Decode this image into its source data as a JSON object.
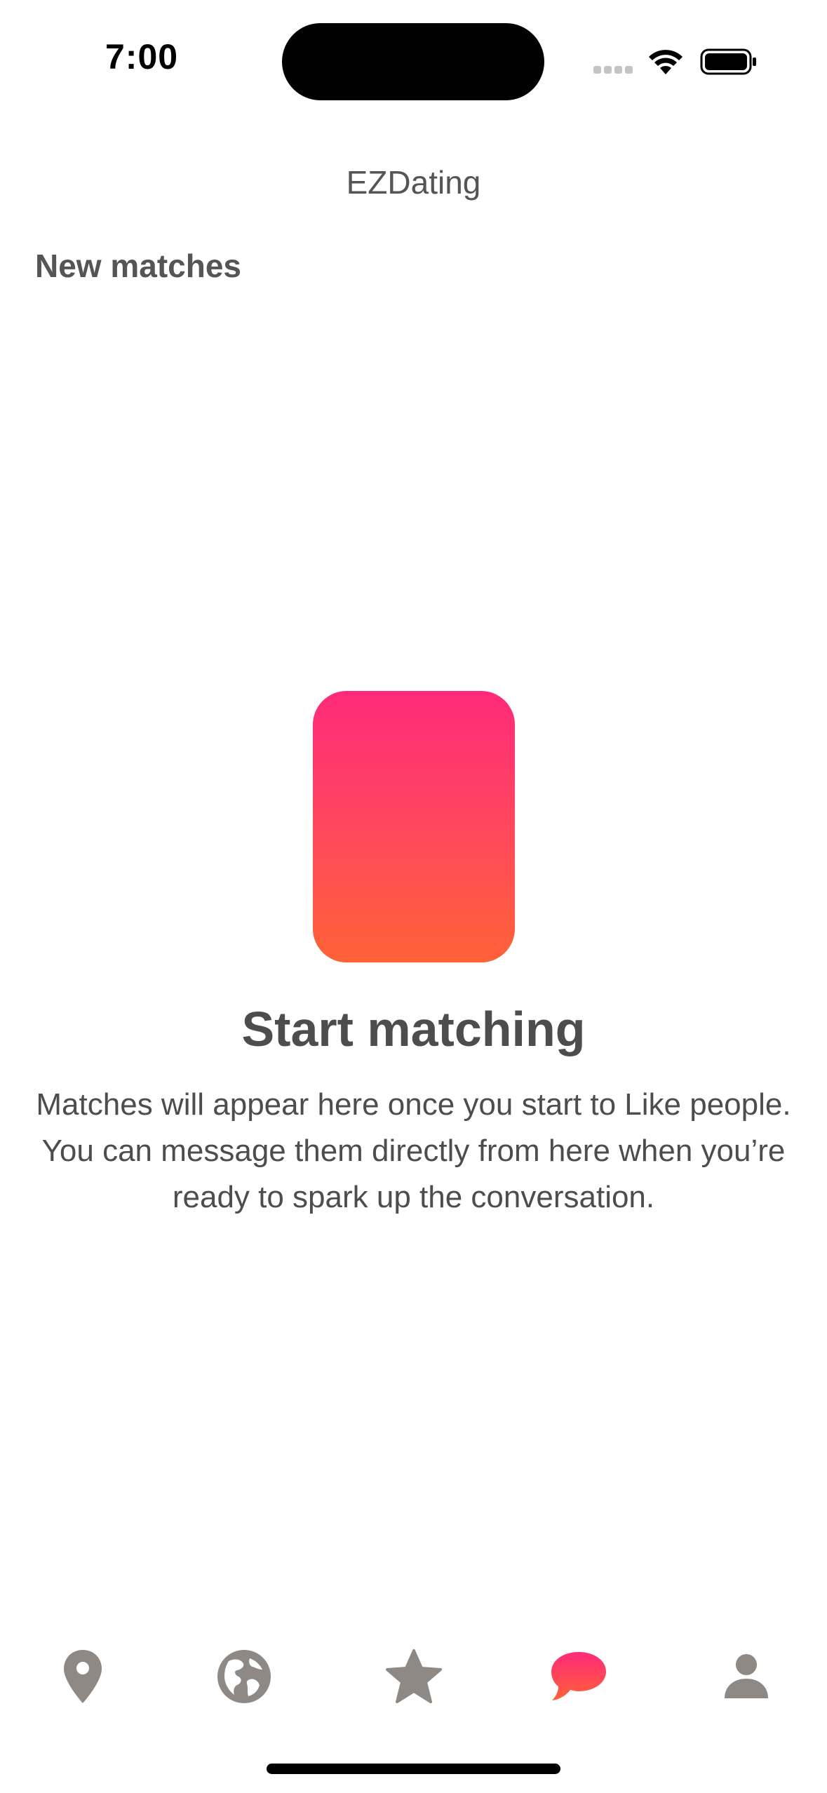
{
  "status_bar": {
    "time": "7:00",
    "icons": [
      "cellular-signal-icon",
      "wifi-icon",
      "battery-icon"
    ]
  },
  "header": {
    "app_title": "EZDating"
  },
  "matches": {
    "section_title": "New matches"
  },
  "empty_state": {
    "title": "Start matching",
    "body": "Matches will appear here once you start to Like people. You can message them directly from here when you’re ready to spark up the conversation.",
    "card_gradient": [
      "#ff2a7a",
      "#ff6237"
    ]
  },
  "tab_bar": {
    "tabs": [
      {
        "icon": "location-pin-icon",
        "active": false
      },
      {
        "icon": "globe-icon",
        "active": false
      },
      {
        "icon": "star-icon",
        "active": false
      },
      {
        "icon": "chat-bubble-icon",
        "active": true
      },
      {
        "icon": "person-icon",
        "active": false
      }
    ],
    "inactive_color": "#8e8985",
    "active_gradient": [
      "#ff2a7a",
      "#ff6237"
    ]
  }
}
